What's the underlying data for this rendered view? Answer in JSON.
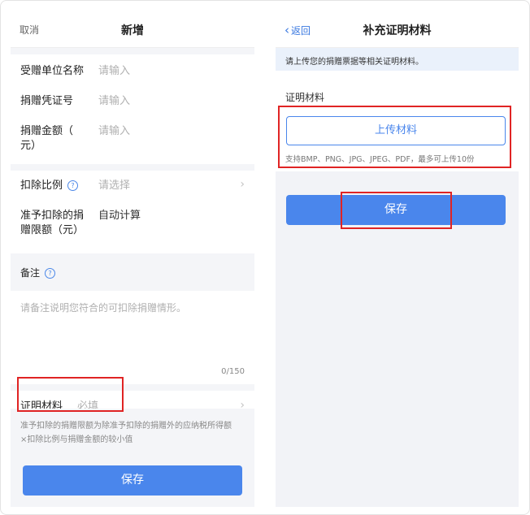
{
  "left": {
    "nav": {
      "cancel": "取消",
      "title": "新增"
    },
    "fields": {
      "recipient_label": "受赠单位名称",
      "recipient_placeholder": "请输入",
      "voucher_label": "捐赠凭证号",
      "voucher_placeholder": "请输入",
      "amount_label_1": "捐赠金额（",
      "amount_label_2": "元）",
      "amount_placeholder": "请输入",
      "ratio_label": "扣除比例",
      "ratio_placeholder": "请选择",
      "limit_label_1": "准予扣除的捐",
      "limit_label_2": "赠限额（元）",
      "limit_value": "自动计算",
      "remark_label": "备注",
      "remark_placeholder": "请备注说明您符合的可扣除捐赠情形。",
      "remark_counter": "0/150",
      "proof_label": "证明材料",
      "proof_value": "必填"
    },
    "footnote_1": "准予扣除的捐赠限额为除准予扣除的捐赠外的应纳税所得额",
    "footnote_2": "×扣除比例与捐赠金额的较小值",
    "save": "保存"
  },
  "right": {
    "nav": {
      "back": "返回",
      "title": "补充证明材料"
    },
    "banner": "请上传您的捐赠票据等相关证明材料。",
    "section_label": "证明材料",
    "upload": "上传材料",
    "formats": "支持BMP、PNG、JPG、JPEG、PDF，最多可上传10份",
    "save": "保存"
  },
  "icons": {
    "help": "?",
    "chevron": "›",
    "back": "‹"
  },
  "colors": {
    "accent": "#4a86ec",
    "highlight": "#e02424"
  }
}
